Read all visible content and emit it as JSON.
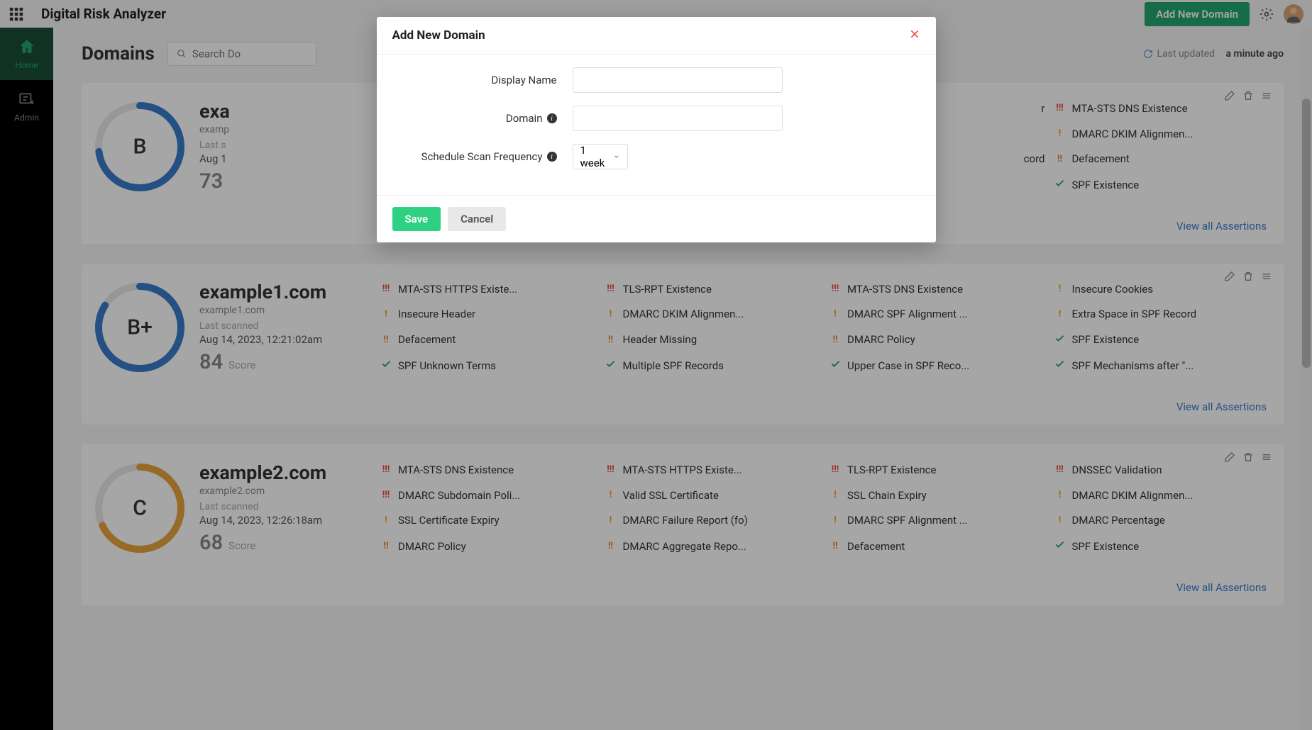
{
  "app_title": "Digital Risk Analyzer",
  "topbar": {
    "add_domain_btn": "Add New Domain"
  },
  "sidebar": {
    "home_label": "Home",
    "admin_label": "Admin"
  },
  "page": {
    "title": "Domains",
    "search_placeholder": "Search Do",
    "last_updated_label": "Last updated",
    "last_updated_value": "a minute ago",
    "view_all": "View all Assertions"
  },
  "modal": {
    "title": "Add New Domain",
    "display_name_label": "Display Name",
    "domain_label": "Domain",
    "frequency_label": "Schedule Scan Frequency",
    "frequency_value": "1 week",
    "save_label": "Save",
    "cancel_label": "Cancel"
  },
  "domains": [
    {
      "name": "exa",
      "url": "examp",
      "scan_label": "Last s",
      "scan_time": "Aug 1",
      "score": "73",
      "score_label": "",
      "grade": "B",
      "grade_color": "#3a7cc9",
      "grade_pct": 73,
      "assertions_col4": [
        {
          "ind": "!!!",
          "cls": "critical",
          "text": "MTA-STS DNS Existence"
        },
        {
          "ind": "!",
          "cls": "medium",
          "text": "DMARC DKIM Alignmen..."
        },
        {
          "ind": "!!",
          "cls": "high",
          "text": "Defacement"
        },
        {
          "ind": "✓",
          "cls": "ok",
          "text": "SPF Existence"
        }
      ],
      "assertions_col3_trail": [
        {
          "text": "r"
        },
        {
          "text": "cord"
        }
      ]
    },
    {
      "name": "example1.com",
      "url": "example1.com",
      "scan_label": "Last scanned",
      "scan_time": "Aug 14, 2023, 12:21:02am",
      "score": "84",
      "score_label": "Score",
      "grade": "B+",
      "grade_color": "#3a7cc9",
      "grade_pct": 84,
      "assertions": [
        {
          "ind": "!!!",
          "cls": "critical",
          "text": "MTA-STS HTTPS Existe..."
        },
        {
          "ind": "!!!",
          "cls": "critical",
          "text": "TLS-RPT Existence"
        },
        {
          "ind": "!!!",
          "cls": "critical",
          "text": "MTA-STS DNS Existence"
        },
        {
          "ind": "!",
          "cls": "medium",
          "text": "Insecure Cookies"
        },
        {
          "ind": "!",
          "cls": "medium",
          "text": "Insecure Header"
        },
        {
          "ind": "!",
          "cls": "medium",
          "text": "DMARC DKIM Alignmen..."
        },
        {
          "ind": "!",
          "cls": "medium",
          "text": "DMARC SPF Alignment ..."
        },
        {
          "ind": "!",
          "cls": "medium",
          "text": "Extra Space in SPF Record"
        },
        {
          "ind": "!!",
          "cls": "high",
          "text": "Defacement"
        },
        {
          "ind": "!!",
          "cls": "high",
          "text": "Header Missing"
        },
        {
          "ind": "!!",
          "cls": "high",
          "text": "DMARC Policy"
        },
        {
          "ind": "✓",
          "cls": "ok",
          "text": "SPF Existence"
        },
        {
          "ind": "✓",
          "cls": "ok",
          "text": "SPF Unknown Terms"
        },
        {
          "ind": "✓",
          "cls": "ok",
          "text": "Multiple SPF Records"
        },
        {
          "ind": "✓",
          "cls": "ok",
          "text": "Upper Case in SPF Reco..."
        },
        {
          "ind": "✓",
          "cls": "ok",
          "text": "SPF Mechanisms after \"..."
        }
      ]
    },
    {
      "name": "example2.com",
      "url": "example2.com",
      "scan_label": "Last scanned",
      "scan_time": "Aug 14, 2023, 12:26:18am",
      "score": "68",
      "score_label": "Score",
      "grade": "C",
      "grade_color": "#e8a33d",
      "grade_pct": 68,
      "assertions": [
        {
          "ind": "!!!",
          "cls": "critical",
          "text": "MTA-STS DNS Existence"
        },
        {
          "ind": "!!!",
          "cls": "critical",
          "text": "MTA-STS HTTPS Existe..."
        },
        {
          "ind": "!!!",
          "cls": "critical",
          "text": "TLS-RPT Existence"
        },
        {
          "ind": "!!!",
          "cls": "critical",
          "text": "DNSSEC Validation"
        },
        {
          "ind": "!!!",
          "cls": "critical",
          "text": "DMARC Subdomain Poli..."
        },
        {
          "ind": "!",
          "cls": "medium",
          "text": "Valid SSL Certificate"
        },
        {
          "ind": "!",
          "cls": "medium",
          "text": "SSL Chain Expiry"
        },
        {
          "ind": "!",
          "cls": "medium",
          "text": "DMARC DKIM Alignmen..."
        },
        {
          "ind": "!",
          "cls": "medium",
          "text": "SSL Certificate Expiry"
        },
        {
          "ind": "!",
          "cls": "medium",
          "text": "DMARC Failure Report (fo)"
        },
        {
          "ind": "!",
          "cls": "medium",
          "text": "DMARC SPF Alignment ..."
        },
        {
          "ind": "!",
          "cls": "medium",
          "text": "DMARC Percentage"
        },
        {
          "ind": "!!",
          "cls": "high",
          "text": "DMARC Policy"
        },
        {
          "ind": "!!",
          "cls": "high",
          "text": "DMARC Aggregate Repo..."
        },
        {
          "ind": "!!",
          "cls": "high",
          "text": "Defacement"
        },
        {
          "ind": "✓",
          "cls": "ok",
          "text": "SPF Existence"
        }
      ]
    }
  ]
}
